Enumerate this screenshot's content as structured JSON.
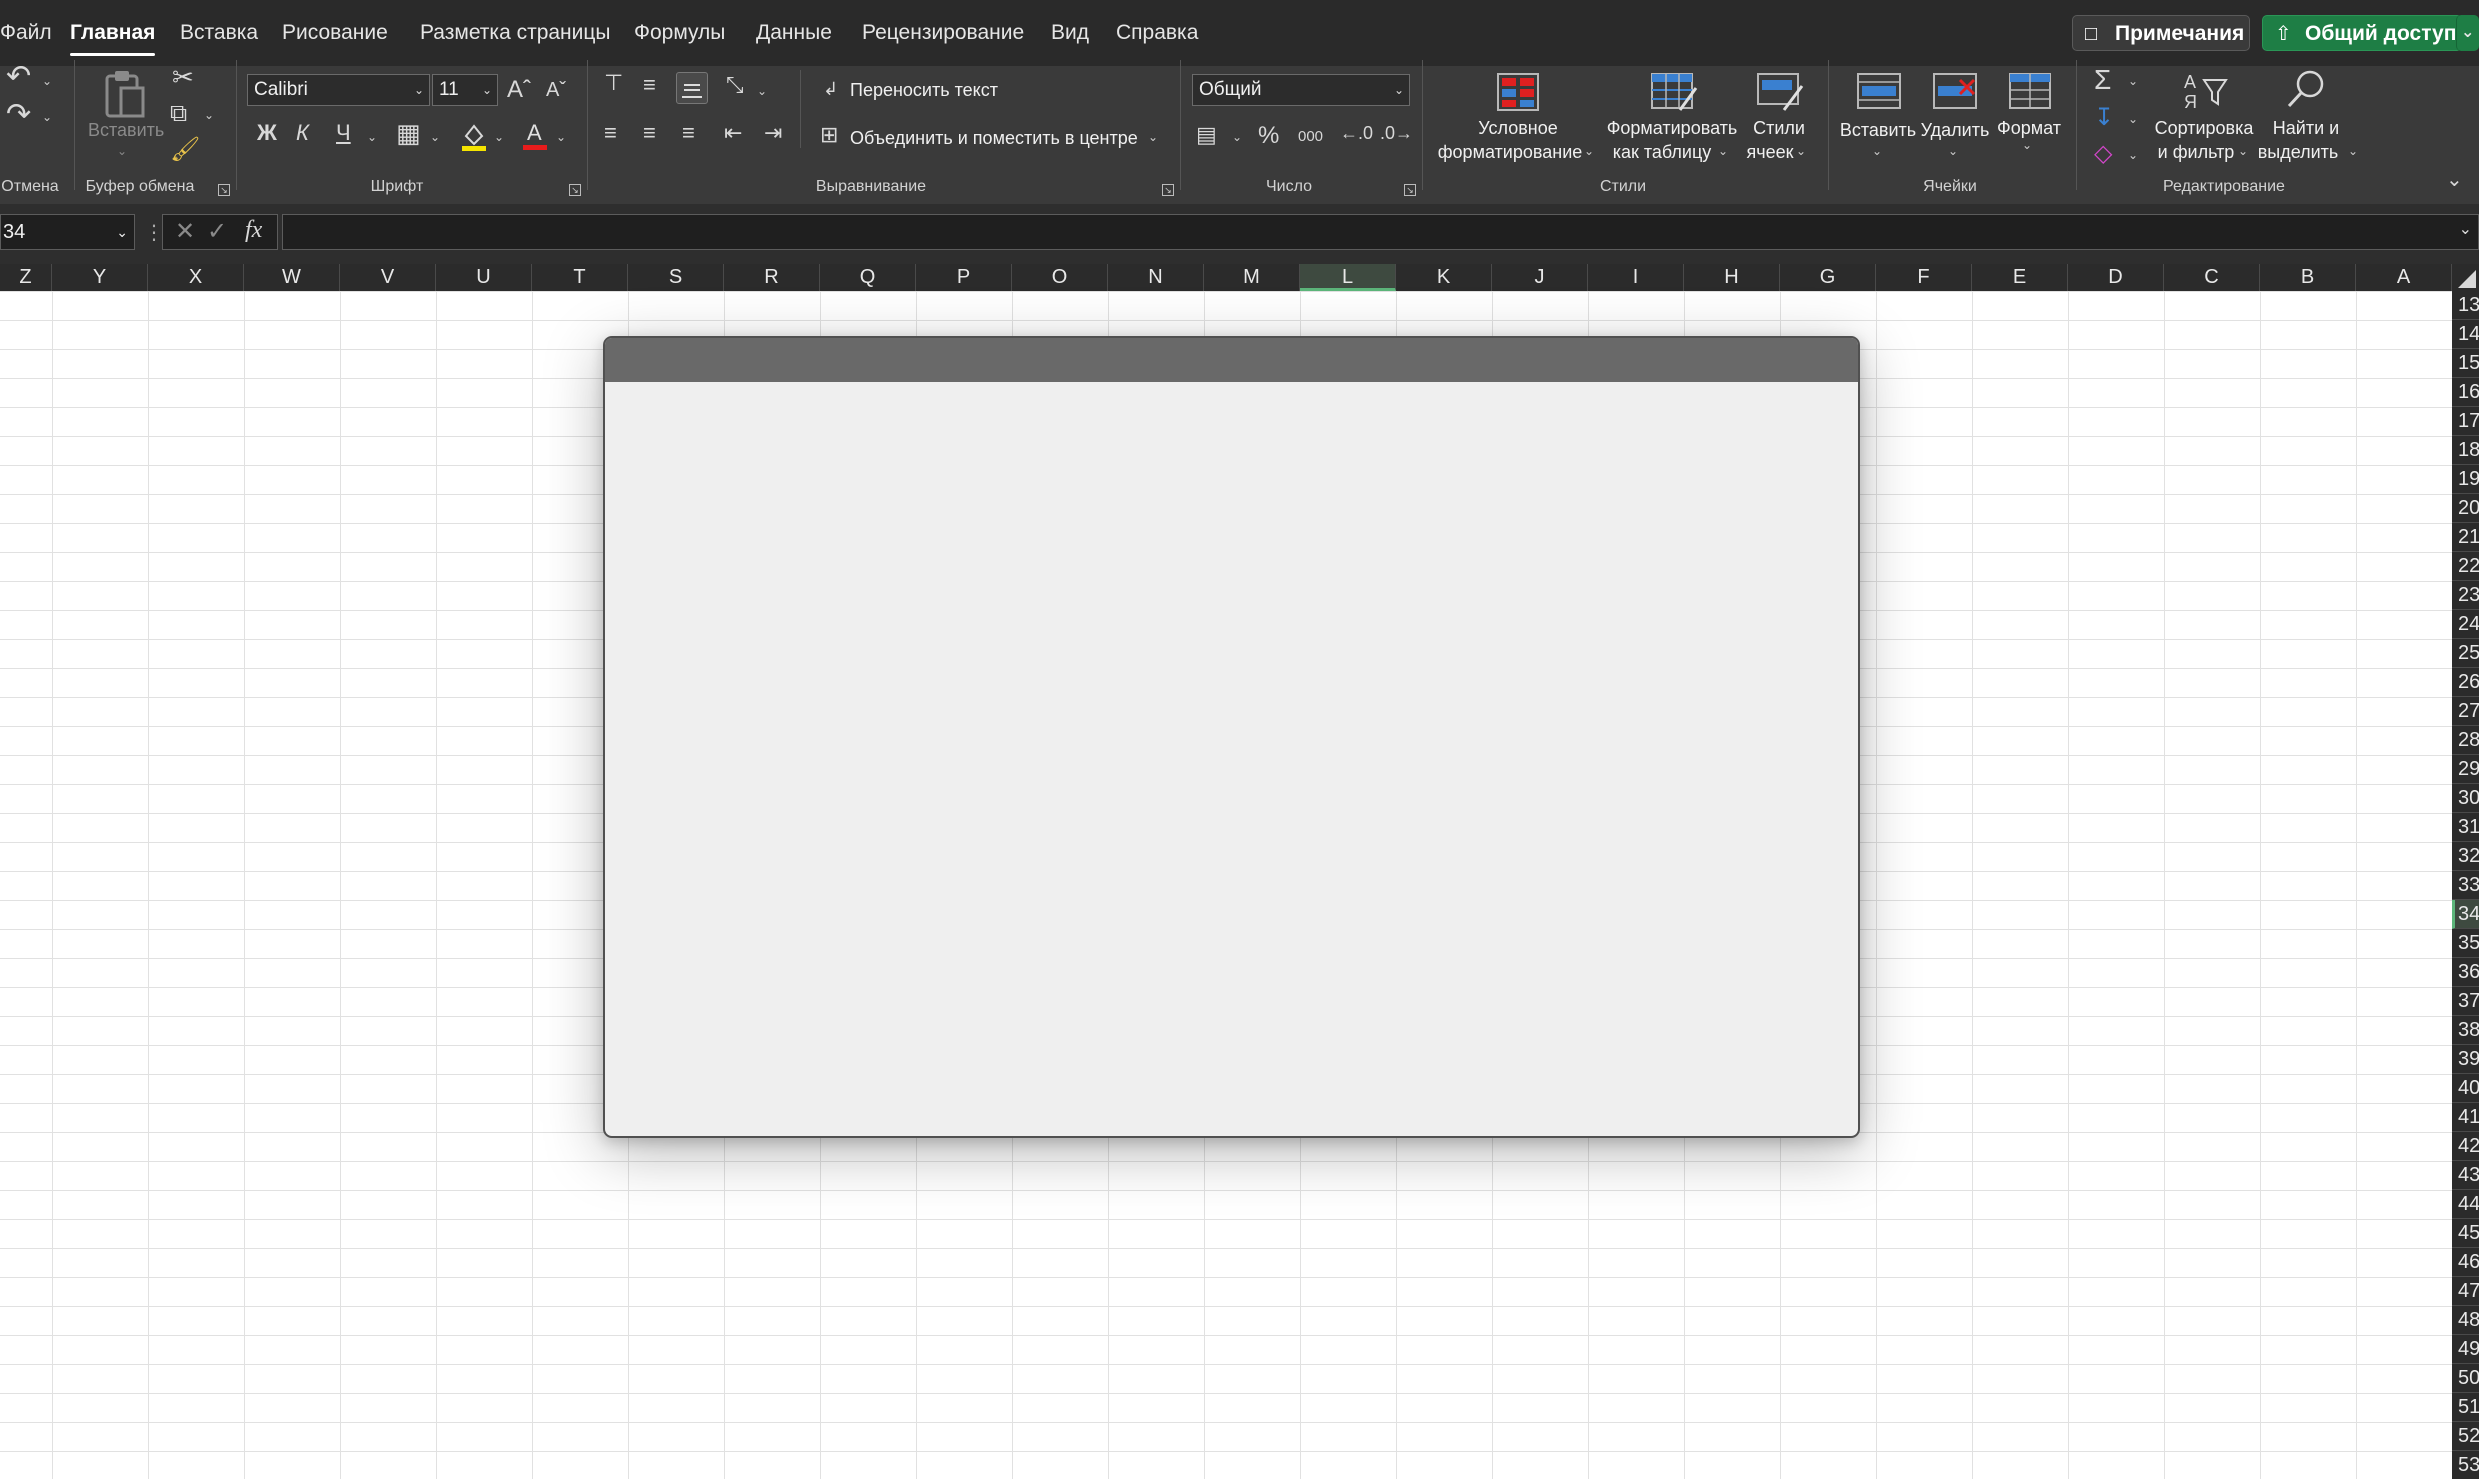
{
  "menu": {
    "tabs": [
      {
        "label": "Файл"
      },
      {
        "label": "Главная",
        "active": true
      },
      {
        "label": "Вставка"
      },
      {
        "label": "Рисование"
      },
      {
        "label": "Разметка страницы"
      },
      {
        "label": "Формулы"
      },
      {
        "label": "Данные"
      },
      {
        "label": "Рецензирование"
      },
      {
        "label": "Вид"
      },
      {
        "label": "Справка"
      }
    ],
    "comments_label": "Примечания",
    "share_label": "Общий доступ"
  },
  "ribbon": {
    "undo_group": "Отмена",
    "clipboard": {
      "paste_label": "Вставить",
      "group": "Буфер обмена"
    },
    "font": {
      "name": "Calibri",
      "size": "11",
      "bold": "Ж",
      "italic": "К",
      "underline": "Ч",
      "group": "Шрифт"
    },
    "alignment": {
      "wrap_text": "Переносить текст",
      "merge_center": "Объединить и поместить в центре",
      "group": "Выравнивание"
    },
    "number": {
      "format": "Общий",
      "percent": "%",
      "thousands": "000",
      "group": "Число"
    },
    "styles": {
      "conditional": [
        "Условное",
        "форматирование"
      ],
      "format_table": [
        "Форматировать",
        "как таблицу"
      ],
      "cell_styles": [
        "Стили",
        "ячеек"
      ],
      "group": "Стили"
    },
    "cells": {
      "insert": "Вставить",
      "delete": "Удалить",
      "format": "Формат",
      "group": "Ячейки"
    },
    "editing": {
      "sort": [
        "Сортировка",
        "и фильтр"
      ],
      "find": [
        "Найти и",
        "выделить"
      ],
      "group": "Редактирование"
    }
  },
  "formula_bar": {
    "name_box": "34",
    "fx": "fx",
    "value": ""
  },
  "columns": [
    "Z",
    "Y",
    "X",
    "W",
    "V",
    "U",
    "T",
    "S",
    "R",
    "Q",
    "P",
    "O",
    "N",
    "M",
    "L",
    "K",
    "J",
    "I",
    "H",
    "G",
    "F",
    "E",
    "D",
    "C",
    "B",
    "A"
  ],
  "selected_column": "L",
  "rows": [
    "13",
    "14",
    "15",
    "16",
    "17",
    "18",
    "19",
    "20",
    "21",
    "22",
    "23",
    "24",
    "25",
    "26",
    "27",
    "28",
    "29",
    "30",
    "31",
    "32",
    "33",
    "34",
    "35",
    "36",
    "37",
    "38",
    "39",
    "40",
    "41",
    "42",
    "43",
    "44",
    "45",
    "46",
    "47",
    "48",
    "49",
    "50",
    "51",
    "52",
    "53"
  ],
  "selected_row": "34",
  "colors": {
    "accent": "#1e7e45",
    "selection": "#5cb57a",
    "dialog_title": "#696969",
    "dialog_body": "#efefef"
  }
}
